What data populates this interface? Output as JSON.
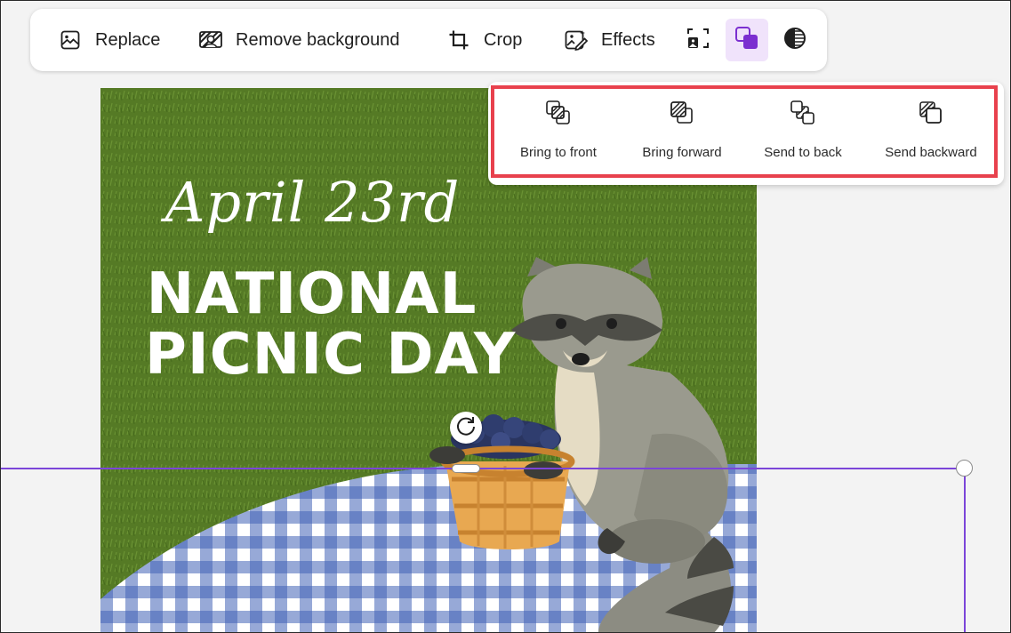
{
  "toolbar": {
    "replace_label": "Replace",
    "remove_bg_label": "Remove background",
    "crop_label": "Crop",
    "effects_label": "Effects",
    "icons": {
      "replace": "image-icon",
      "remove_bg": "remove-background-icon",
      "crop": "crop-icon",
      "effects": "effects-icon",
      "frame": "frame-icon",
      "arrange": "arrange-icon",
      "adjust": "adjust-icon"
    },
    "active_tool": "arrange"
  },
  "arrange_menu": {
    "items": [
      {
        "label": "Bring to front",
        "icon": "bring-to-front-icon"
      },
      {
        "label": "Bring forward",
        "icon": "bring-forward-icon"
      },
      {
        "label": "Send to back",
        "icon": "send-to-back-icon"
      },
      {
        "label": "Send backward",
        "icon": "send-backward-icon"
      }
    ],
    "highlight_color": "#e8414d"
  },
  "card": {
    "date": "April 23rd",
    "title_line1": "NATIONAL",
    "title_line2": "PICNIC DAY"
  },
  "colors": {
    "accent": "#7b45d8",
    "active_bg": "#f0e3fb",
    "grass": "#557a25",
    "checker_blue": "#4263b6"
  }
}
